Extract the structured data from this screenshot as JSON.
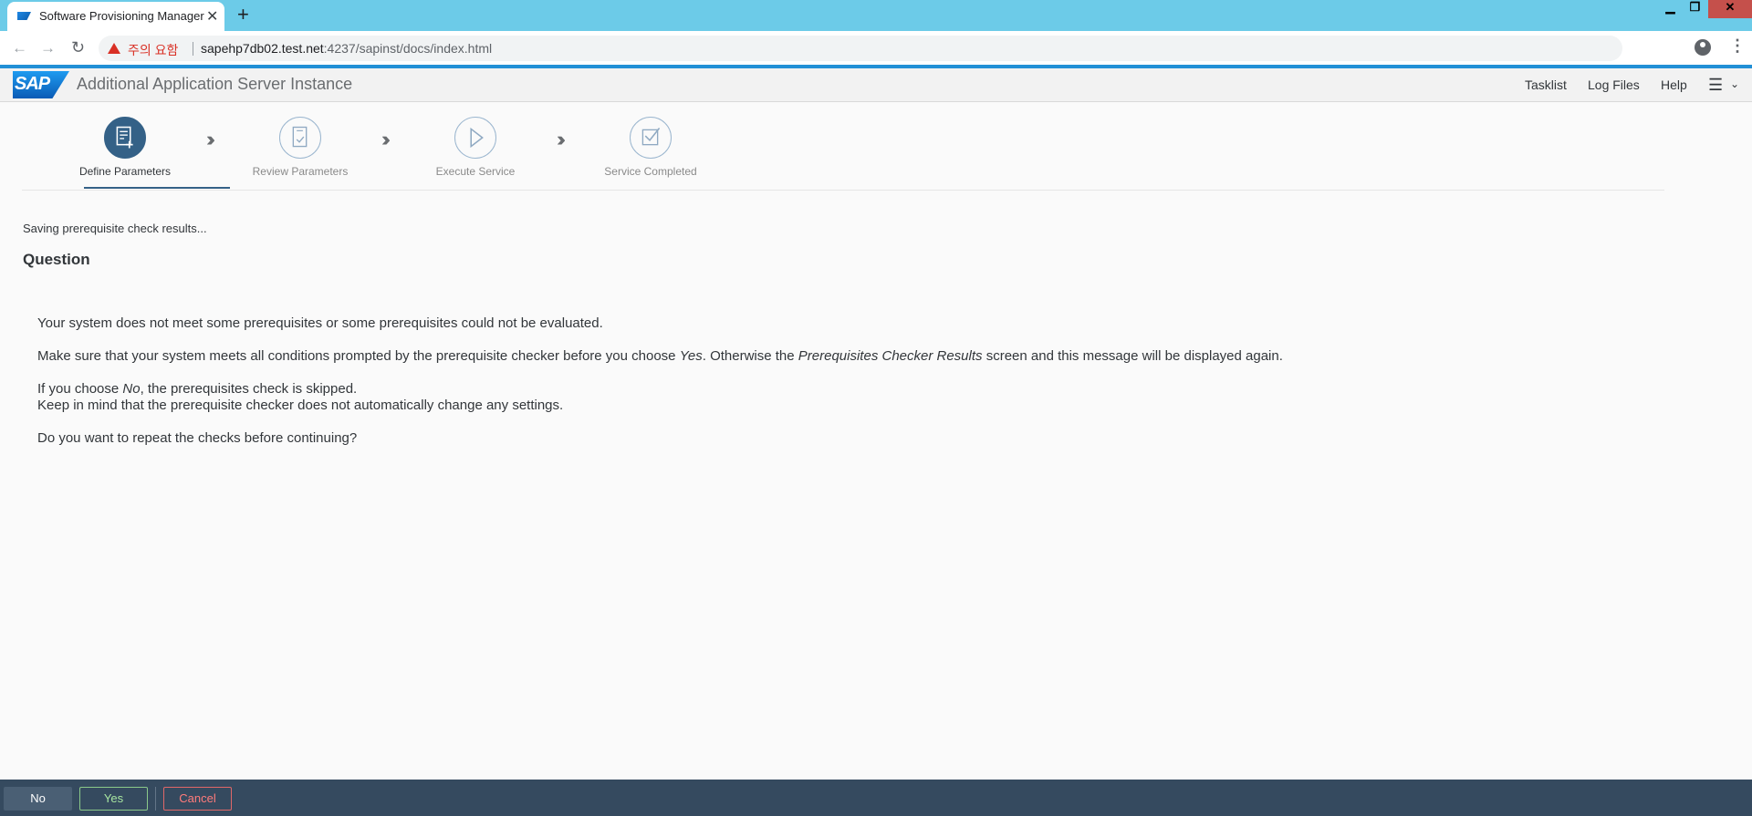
{
  "browser": {
    "tab_title": "Software Provisioning Manager",
    "tab_close": "✕",
    "new_tab": "+",
    "window_controls": {
      "minimize": "▁",
      "maximize": "❐",
      "close": "✕"
    },
    "nav": {
      "back": "←",
      "forward": "→",
      "reload": "↻"
    },
    "security_warning": "주의 요함",
    "url_host": "sapehp7db02.test.net",
    "url_path": ":4237/sapinst/docs/index.html",
    "bookmark_star": "☆",
    "menu": "⋮"
  },
  "shell": {
    "logo_text": "SAP",
    "title": "Additional Application Server Instance",
    "links": {
      "tasklist": "Tasklist",
      "log_files": "Log Files",
      "help": "Help"
    },
    "menu_icon": "☰",
    "menu_chevron": "⌄"
  },
  "roadmap": {
    "steps": [
      {
        "label": "Define Parameters",
        "active": true
      },
      {
        "label": "Review Parameters",
        "active": false
      },
      {
        "label": "Execute Service",
        "active": false
      },
      {
        "label": "Service Completed",
        "active": false
      }
    ],
    "separator": "›››"
  },
  "content": {
    "status": "Saving prerequisite check results...",
    "heading": "Question",
    "line1": "Your system does not meet some prerequisites or some prerequisites could not be evaluated.",
    "line2_a": "Make sure that your system meets all conditions prompted by the prerequisite checker before you choose ",
    "line2_yes": "Yes",
    "line2_b": ". Otherwise the ",
    "line2_results": "Prerequisites Checker Results",
    "line2_c": " screen and this message will be displayed again.",
    "line3_a": "If you choose ",
    "line3_no": "No",
    "line3_b": ", the prerequisites check is skipped.",
    "line4": "Keep in mind that the prerequisite checker does not automatically change any settings.",
    "line5": "Do you want to repeat the checks before continuing?"
  },
  "footer": {
    "no": "No",
    "yes": "Yes",
    "cancel": "Cancel"
  },
  "colors": {
    "tabbar": "#6ccbe8",
    "accent": "#2290d6",
    "step_active": "#346187",
    "footer": "#354a5f"
  }
}
